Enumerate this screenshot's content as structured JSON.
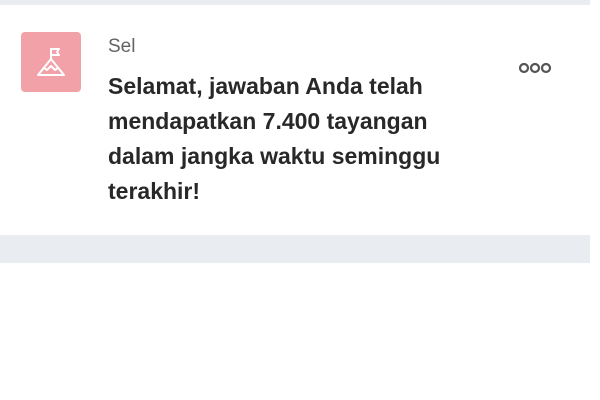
{
  "notification": {
    "sender": "Sel",
    "message": "Selamat, jawaban Anda telah mendapatkan 7.400 tayangan dalam jangka waktu seminggu terakhir!",
    "icon": "mountain-flag-icon",
    "icon_bg_color": "#f3a1a9",
    "more_icon": "more-options-icon"
  },
  "colors": {
    "separator": "#e9edf2",
    "message_text": "#282828",
    "sender_text": "#646464"
  }
}
